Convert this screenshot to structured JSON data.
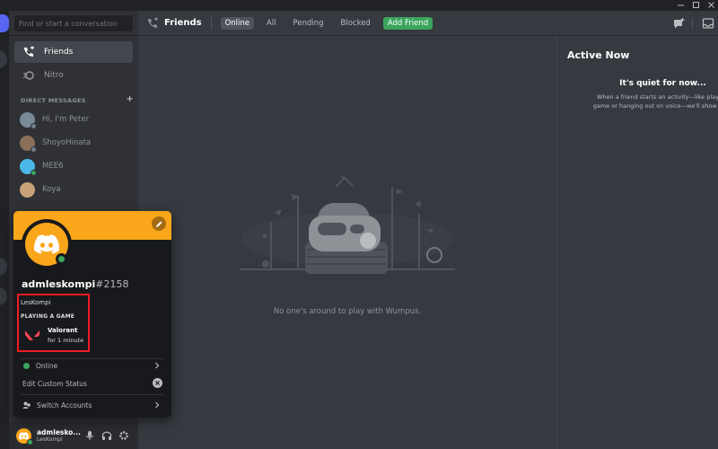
{
  "search": {
    "placeholder": "Find or start a conversation"
  },
  "nav": {
    "friends_label": "Friends",
    "nitro_label": "Nitro"
  },
  "dm_section": {
    "header": "DIRECT MESSAGES",
    "add": "+"
  },
  "dms": [
    {
      "name": "Hi, I'm Peter"
    },
    {
      "name": "ShoyoHinata"
    },
    {
      "name": "MEE6"
    },
    {
      "name": "Koya"
    }
  ],
  "header": {
    "title": "Friends",
    "tabs": [
      "Online",
      "All",
      "Pending",
      "Blocked"
    ],
    "add_friend": "Add Friend"
  },
  "main": {
    "empty_text": "No one's around to play with Wumpus."
  },
  "active_now": {
    "title": "Active Now",
    "quiet": "It's quiet for now...",
    "desc_line1": "When a friend starts an activity—like playing",
    "desc_line2": "game or hanging out on voice—we'll show it he"
  },
  "profile": {
    "username": "admleskompi",
    "discriminator": "#2158",
    "nickname": "LesKompi",
    "activity_header": "PLAYING A GAME",
    "game_name": "Valorant",
    "game_time": "for 1 minute",
    "status_label": "Online",
    "custom_status_label": "Edit Custom Status",
    "switch_accounts_label": "Switch Accounts"
  },
  "user_panel": {
    "name": "admlesko...",
    "tag": "LesKompi"
  },
  "colors": {
    "accent": "#faa61a",
    "online": "#3ba55d",
    "blurple": "#5865f2",
    "highlight": "#ed1c24"
  }
}
